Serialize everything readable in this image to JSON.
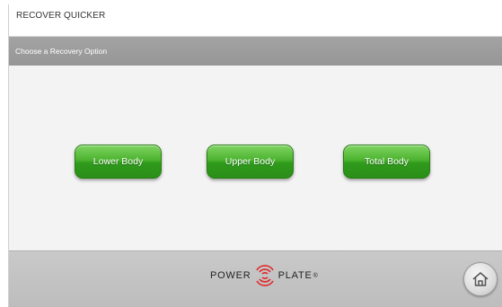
{
  "header": {
    "title": "RECOVER QUICKER"
  },
  "subheader": {
    "label": "Choose a Recovery Option"
  },
  "options": {
    "lower": "Lower Body",
    "upper": "Upper Body",
    "total": "Total Body"
  },
  "footer": {
    "logo_left": "POWER",
    "logo_right": "PLATE",
    "logo_mark": "®",
    "home_icon": "home-icon"
  },
  "colors": {
    "button_green": "#3fa82a",
    "header_gray": "#9d9d9d",
    "footer_gray": "#c4c4c4",
    "logo_red": "#e0262b"
  }
}
